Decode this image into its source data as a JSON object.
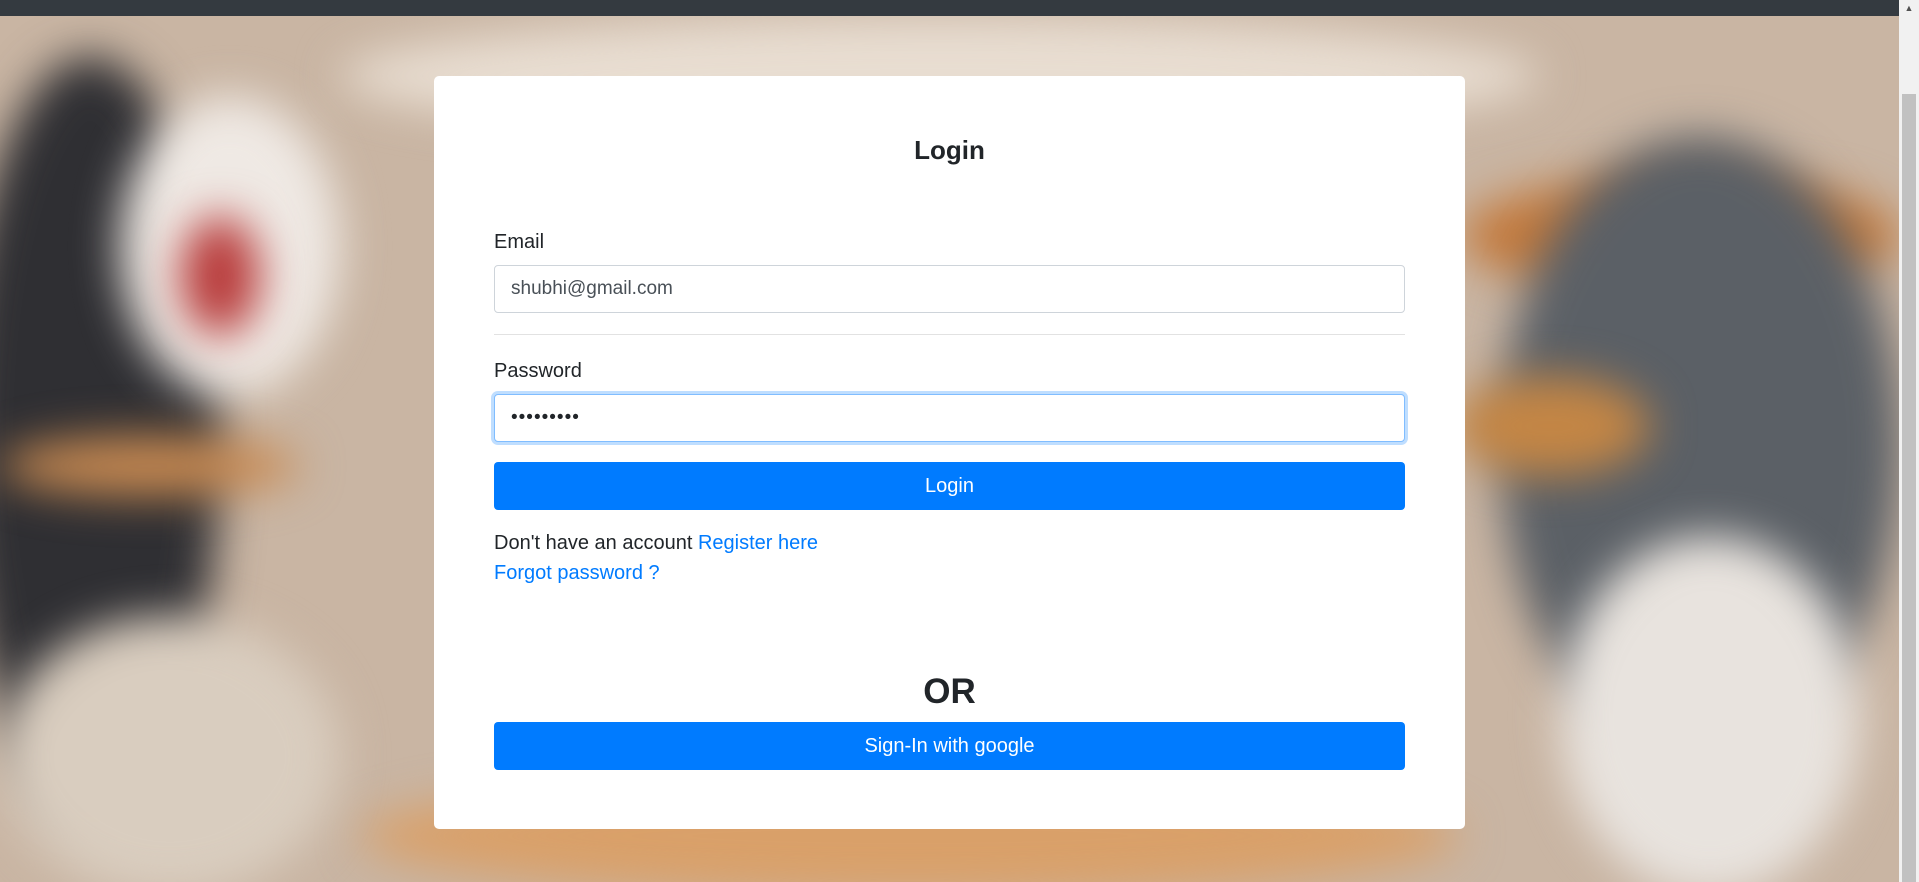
{
  "card": {
    "title": "Login"
  },
  "form": {
    "email_label": "Email",
    "email_value": "shubhi@gmail.com",
    "password_label": "Password",
    "password_value": "•••••••••",
    "login_button": "Login"
  },
  "links": {
    "no_account_text": "Don't have an account",
    "register_link": "Register here",
    "forgot_password_link": "Forgot password ?"
  },
  "alternative": {
    "or_text": "OR",
    "google_button": "Sign-In with google"
  },
  "colors": {
    "primary": "#007bff",
    "topbar": "#343a40",
    "card_bg": "#ffffff"
  }
}
